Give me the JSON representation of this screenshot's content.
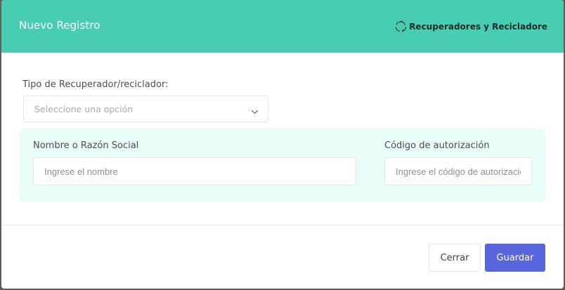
{
  "modal": {
    "title": "Nuevo Registro",
    "brand_label": "Recuperadores y Recicladore",
    "brand_icon": "recycle-icon"
  },
  "form": {
    "type_label": "Tipo de Recuperador/reciclador:",
    "type_select_value": "Seleccione una opción",
    "name_label": "Nombre o Razón Social",
    "name_placeholder": "Ingrese el nombre",
    "name_value": "",
    "auth_label": "Código de autorización",
    "auth_placeholder": "Ingrese el código de autorización",
    "auth_value": ""
  },
  "footer": {
    "close_label": "Cerrar",
    "save_label": "Guardar"
  },
  "colors": {
    "header_bg": "#48cdb2",
    "panel_bg": "#e8fcf8",
    "primary_button": "#5865dc"
  }
}
